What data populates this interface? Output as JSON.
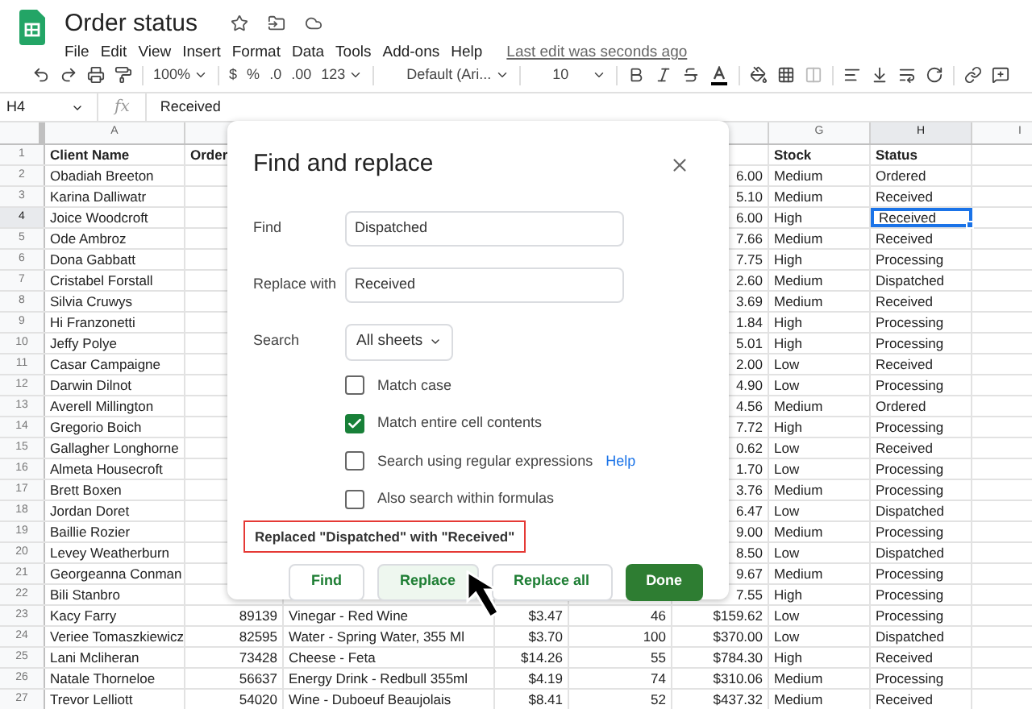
{
  "app": {
    "title": "Order status",
    "menu": [
      "File",
      "Edit",
      "View",
      "Insert",
      "Format",
      "Data",
      "Tools",
      "Add-ons",
      "Help"
    ],
    "last_edit": "Last edit was seconds ago"
  },
  "toolbar": {
    "zoom": "100%",
    "currency": "$",
    "percent": "%",
    "decrease_decimal": ".0",
    "increase_decimal": ".00",
    "number_format": "123",
    "font": "Default (Ari...",
    "font_size": "10"
  },
  "formula_bar": {
    "cell": "H4",
    "function_label": "fx",
    "value": "Received"
  },
  "columns": [
    {
      "label": "A",
      "selected": false
    },
    {},
    {},
    {},
    {},
    {},
    {
      "label": "G",
      "selected": false
    },
    {
      "label": "H",
      "selected": true
    },
    {
      "label": "I",
      "selected": false
    }
  ],
  "rows": [
    {
      "number": "1",
      "selected": false,
      "kind": "header",
      "cells": [
        "Client Name",
        "Order",
        null,
        null,
        null,
        null,
        "Stock",
        "Status",
        null
      ]
    },
    {
      "number": "2",
      "selected": false,
      "cells": [
        "Obadiah Breeton",
        null,
        null,
        null,
        null,
        "6.00",
        "Medium",
        "Ordered",
        null
      ]
    },
    {
      "number": "3",
      "selected": false,
      "cells": [
        "Karina Dalliwatr",
        null,
        null,
        null,
        null,
        "5.10",
        "Medium",
        "Received",
        null
      ]
    },
    {
      "number": "4",
      "selected": true,
      "cells": [
        "Joice Woodcroft",
        null,
        null,
        null,
        null,
        "6.00",
        "High",
        "Received",
        null
      ]
    },
    {
      "number": "5",
      "selected": false,
      "cells": [
        "Ode Ambroz",
        null,
        null,
        null,
        null,
        "7.66",
        "Medium",
        "Received",
        null
      ]
    },
    {
      "number": "6",
      "selected": false,
      "cells": [
        "Dona Gabbatt",
        null,
        null,
        null,
        null,
        "7.75",
        "High",
        "Processing",
        null
      ]
    },
    {
      "number": "7",
      "selected": false,
      "cells": [
        "Cristabel Forstall",
        null,
        null,
        null,
        null,
        "2.60",
        "Medium",
        "Dispatched",
        null
      ]
    },
    {
      "number": "8",
      "selected": false,
      "cells": [
        "Silvia Cruwys",
        null,
        null,
        null,
        null,
        "3.69",
        "Medium",
        "Received",
        null
      ]
    },
    {
      "number": "9",
      "selected": false,
      "cells": [
        "Hi Franzonetti",
        null,
        null,
        null,
        null,
        "1.84",
        "High",
        "Processing",
        null
      ]
    },
    {
      "number": "10",
      "selected": false,
      "cells": [
        "Jeffy Polye",
        null,
        null,
        null,
        null,
        "5.01",
        "High",
        "Processing",
        null
      ]
    },
    {
      "number": "11",
      "selected": false,
      "cells": [
        "Casar Campaigne",
        null,
        null,
        null,
        null,
        "2.00",
        "Low",
        "Received",
        null
      ]
    },
    {
      "number": "12",
      "selected": false,
      "cells": [
        "Darwin Dilnot",
        null,
        null,
        null,
        null,
        "4.90",
        "Low",
        "Processing",
        null
      ]
    },
    {
      "number": "13",
      "selected": false,
      "cells": [
        "Averell Millington",
        null,
        null,
        null,
        null,
        "4.56",
        "Medium",
        "Ordered",
        null
      ]
    },
    {
      "number": "14",
      "selected": false,
      "cells": [
        "Gregorio Boich",
        null,
        null,
        null,
        null,
        "7.72",
        "High",
        "Processing",
        null
      ]
    },
    {
      "number": "15",
      "selected": false,
      "cells": [
        "Gallagher Longhorne",
        null,
        null,
        null,
        null,
        "0.62",
        "Low",
        "Received",
        null
      ]
    },
    {
      "number": "16",
      "selected": false,
      "cells": [
        "Almeta Housecroft",
        null,
        null,
        null,
        null,
        "1.70",
        "Low",
        "Processing",
        null
      ]
    },
    {
      "number": "17",
      "selected": false,
      "cells": [
        "Brett Boxen",
        null,
        null,
        null,
        null,
        "3.76",
        "Medium",
        "Processing",
        null
      ]
    },
    {
      "number": "18",
      "selected": false,
      "cells": [
        "Jordan Doret",
        null,
        null,
        null,
        null,
        "6.47",
        "Low",
        "Dispatched",
        null
      ]
    },
    {
      "number": "19",
      "selected": false,
      "cells": [
        "Baillie Rozier",
        null,
        null,
        null,
        null,
        "9.00",
        "Medium",
        "Processing",
        null
      ]
    },
    {
      "number": "20",
      "selected": false,
      "cells": [
        "Levey Weatherburn",
        null,
        null,
        null,
        null,
        "8.50",
        "Low",
        "Dispatched",
        null
      ]
    },
    {
      "number": "21",
      "selected": false,
      "cells": [
        "Georgeanna Conman",
        null,
        null,
        null,
        null,
        "9.67",
        "Medium",
        "Processing",
        null
      ]
    },
    {
      "number": "22",
      "selected": false,
      "cells": [
        "Bili Stanbro",
        null,
        null,
        null,
        null,
        "7.55",
        "High",
        "Processing",
        null
      ]
    },
    {
      "number": "23",
      "selected": false,
      "cells": [
        "Kacy Farry",
        "89139",
        "Vinegar - Red Wine",
        "$3.47",
        "46",
        "$159.62",
        "Low",
        "Processing",
        null
      ]
    },
    {
      "number": "24",
      "selected": false,
      "cells": [
        "Veriee Tomaszkiewicz",
        "82595",
        "Water - Spring Water, 355 Ml",
        "$3.70",
        "100",
        "$370.00",
        "Low",
        "Dispatched",
        null
      ]
    },
    {
      "number": "25",
      "selected": false,
      "cells": [
        "Lani Mcliheran",
        "73428",
        "Cheese - Feta",
        "$14.26",
        "55",
        "$784.30",
        "High",
        "Received",
        null
      ]
    },
    {
      "number": "26",
      "selected": false,
      "cells": [
        "Natale Thorneloe",
        "56637",
        "Energy Drink - Redbull 355ml",
        "$4.19",
        "74",
        "$310.06",
        "Medium",
        "Processing",
        null
      ]
    },
    {
      "number": "27",
      "selected": false,
      "cells": [
        "Trevor Lelliott",
        "54020",
        "Wine - Duboeuf Beaujolais",
        "$8.41",
        "52",
        "$437.32",
        "Medium",
        "Received",
        null
      ]
    }
  ],
  "dialog": {
    "title": "Find and replace",
    "fields": [
      {
        "label": "Find",
        "value": "Dispatched"
      },
      {
        "label": "Replace with",
        "value": "Received"
      }
    ],
    "search": {
      "label": "Search",
      "value": "All sheets"
    },
    "options": [
      {
        "label": "Match case",
        "checked": false
      },
      {
        "label": "Match entire cell contents",
        "checked": true
      },
      {
        "label": "Search using regular expressions",
        "checked": false,
        "link": "Help"
      },
      {
        "label": "Also search within formulas",
        "checked": false
      }
    ],
    "message": "Replaced \"Dispatched\" with \"Received\"",
    "buttons": [
      {
        "label": "Find",
        "kind": "secondary",
        "hovered": false
      },
      {
        "label": "Replace",
        "kind": "secondary",
        "hovered": true
      },
      {
        "label": "Replace all",
        "kind": "secondary",
        "hovered": false
      },
      {
        "label": "Done",
        "kind": "primary",
        "hovered": false
      }
    ]
  }
}
